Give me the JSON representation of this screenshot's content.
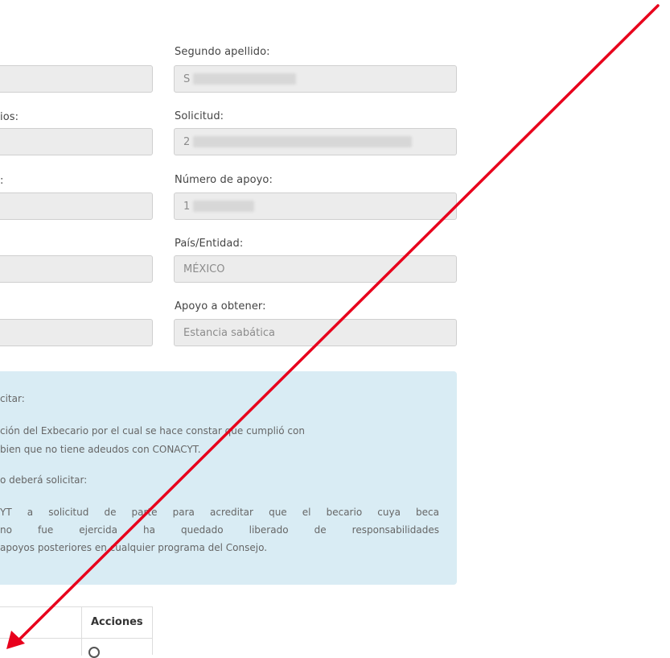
{
  "form": {
    "labels": {
      "segundo_apellido": "Segundo apellido:",
      "left_ios": "ios:",
      "solicitud": "Solicitud:",
      "left_colon": ":",
      "numero_apoyo": "Número de apoyo:",
      "pais_entidad": "País/Entidad:",
      "apoyo_obtener": "Apoyo a obtener:"
    },
    "values": {
      "segundo_apellido": "S",
      "solicitud": "2",
      "numero_apoyo": "1",
      "pais_entidad": "MÉXICO",
      "apoyo_obtener": "Estancia sabática"
    }
  },
  "info": {
    "line1": "citar:",
    "line2": "ción del Exbecario por el cual se hace constar que cumplió con",
    "line3": "bien que no tiene adeudos con CONACYT.",
    "line4": "o deberá solicitar:",
    "line5": "YT a solicitud de parte para acreditar que el becario cuya beca",
    "line6": "no fue ejercida ha quedado liberado de responsabilidades",
    "line7": "apoyos posteriores en cualquier programa del Consejo."
  },
  "table": {
    "header_acciones": "Acciones"
  },
  "annotation": {
    "arrow_color": "#e8001c"
  }
}
